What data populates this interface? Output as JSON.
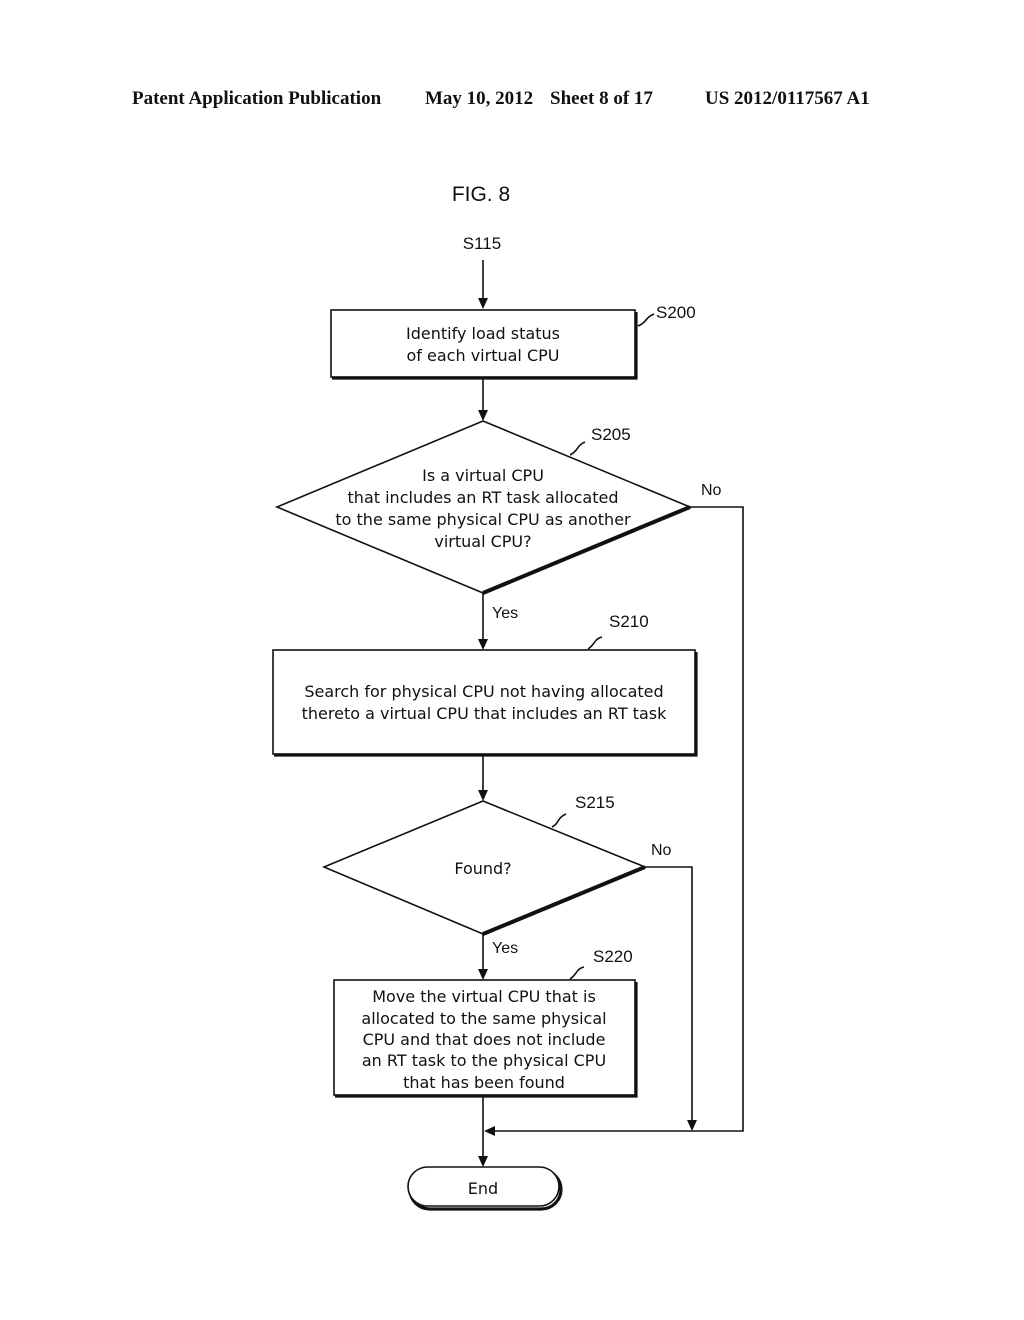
{
  "header": {
    "publication": "Patent Application Publication",
    "date": "May 10, 2012",
    "sheet": "Sheet 8 of 17",
    "number": "US 2012/0117567 A1"
  },
  "figure": {
    "title": "FIG. 8",
    "entry": "S115",
    "steps": {
      "s200": {
        "id": "S200",
        "type": "process",
        "lines": [
          "Identify load status",
          "of each virtual CPU"
        ]
      },
      "s205": {
        "id": "S205",
        "type": "decision",
        "lines": [
          "Is a virtual CPU",
          "that includes an RT task allocated",
          "to the same physical CPU as another",
          "virtual CPU?"
        ],
        "yes": "Yes",
        "no": "No"
      },
      "s210": {
        "id": "S210",
        "type": "process",
        "lines": [
          "Search for physical CPU not having allocated",
          "thereto a virtual CPU that includes an RT task"
        ]
      },
      "s215": {
        "id": "S215",
        "type": "decision",
        "lines": [
          "Found?"
        ],
        "yes": "Yes",
        "no": "No"
      },
      "s220": {
        "id": "S220",
        "type": "process",
        "lines": [
          "Move the virtual CPU that is",
          "allocated to the same physical",
          "CPU and that does not include",
          "an RT task to the physical CPU",
          "that has been found"
        ]
      }
    },
    "end": "End",
    "edges": [
      {
        "from": "S115",
        "to": "S200"
      },
      {
        "from": "S200",
        "to": "S205"
      },
      {
        "from": "S205",
        "to": "S210",
        "label": "Yes"
      },
      {
        "from": "S205",
        "to": "End",
        "label": "No"
      },
      {
        "from": "S210",
        "to": "S215"
      },
      {
        "from": "S215",
        "to": "S220",
        "label": "Yes"
      },
      {
        "from": "S215",
        "to": "End",
        "label": "No"
      },
      {
        "from": "S220",
        "to": "End"
      }
    ]
  }
}
